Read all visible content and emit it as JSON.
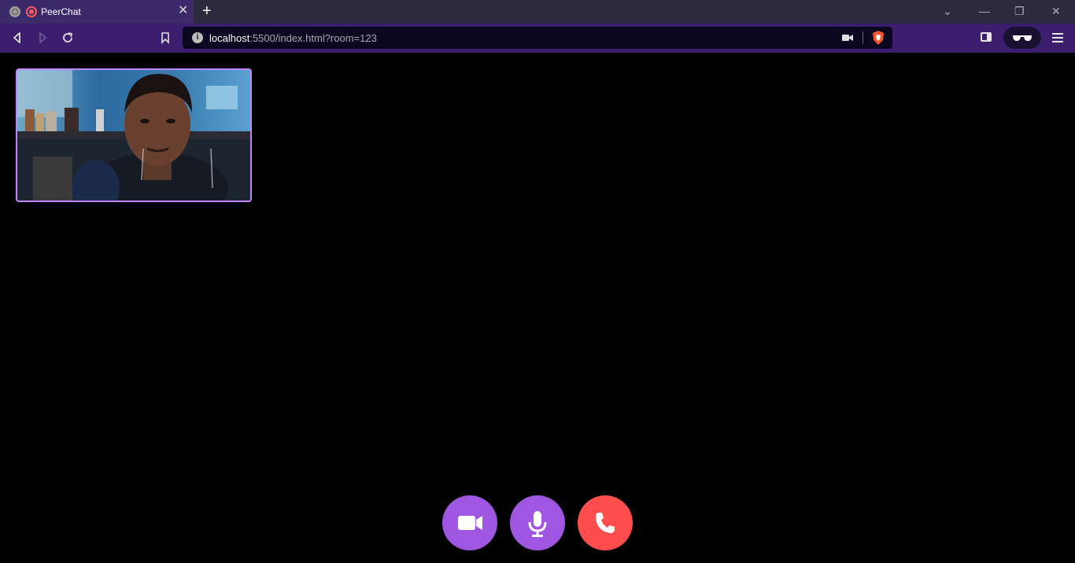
{
  "browser": {
    "tab_title": "PeerChat",
    "tab_close": "✕",
    "new_tab": "+",
    "window_controls": [
      "⌄",
      "—",
      "❐",
      "✕"
    ],
    "url_host": "localhost",
    "url_rest": ":5500/index.html?room=123"
  },
  "call": {
    "controls": [
      {
        "name": "camera",
        "icon": "video-camera-icon",
        "color": "#9f56e0"
      },
      {
        "name": "mic",
        "icon": "microphone-icon",
        "color": "#9f56e0"
      },
      {
        "name": "leave",
        "icon": "phone-icon",
        "color": "#ff4d4d"
      }
    ],
    "video_border_color": "#c084fc"
  }
}
